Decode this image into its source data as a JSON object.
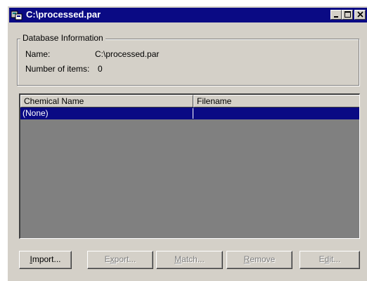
{
  "window": {
    "title": "C:\\processed.par",
    "icon": "database-window-icon",
    "controls": [
      "minimize-icon",
      "maximize-icon",
      "close-icon"
    ]
  },
  "database_info": {
    "legend": "Database Information",
    "name_label": "Name:",
    "name_value": "C:\\processed.par",
    "count_label": "Number of items:",
    "count_value": "0"
  },
  "list": {
    "columns": [
      "Chemical Name",
      "Filename"
    ],
    "rows": [
      {
        "chemical_name": "(None)",
        "filename": "",
        "selected": true
      }
    ]
  },
  "buttons": [
    {
      "label_pre": "",
      "accel": "I",
      "label_post": "mport...",
      "enabled": true
    },
    {
      "label_pre": "E",
      "accel": "x",
      "label_post": "port...",
      "enabled": false
    },
    {
      "label_pre": "",
      "accel": "M",
      "label_post": "atch...",
      "enabled": false
    },
    {
      "label_pre": "",
      "accel": "R",
      "label_post": "emove",
      "enabled": false
    },
    {
      "label_pre": "E",
      "accel": "d",
      "label_post": "it...",
      "enabled": false
    }
  ],
  "colors": {
    "titlebar": "#0a0a84",
    "face": "#d4d0c8",
    "list_background": "#808080",
    "selection": "#0a0a84"
  }
}
